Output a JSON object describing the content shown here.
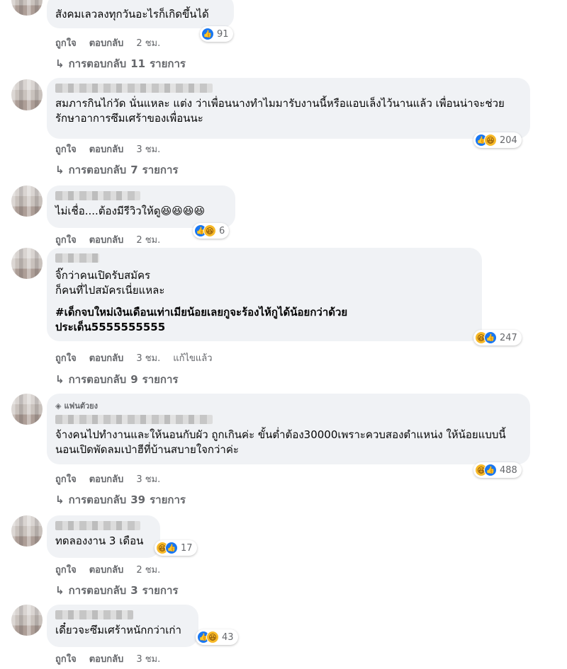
{
  "labels": {
    "like": "ถูกใจ",
    "reply": "ตอบกลับ"
  },
  "reply_prefix": "การตอบกลับ",
  "reply_suffix": "รายการ",
  "comments": [
    {
      "text": "สังคมเลวลงทุกวันอะไรก็เกิดขึ้นได้",
      "reactions": [
        "like"
      ],
      "count": "91",
      "time": "2 ชม.",
      "replies": "11"
    },
    {
      "text": "สมภารกินไก่วัด นั่นแหละ แต่ง ว่าเพื่อนนางทำไมมารับงานนี้หรือแอบเล็งไว้นานแล้ว เพื่อนน่าจะช่วยรักษาอาการซึมเศร้าของเพื่อนนะ",
      "reactions": [
        "like",
        "haha"
      ],
      "count": "204",
      "time": "3 ชม.",
      "replies": "7"
    },
    {
      "text": "ไม่เชื่อ....ต้องมีรีวิวให้ดู😆😆😆😆",
      "reactions": [
        "like",
        "haha"
      ],
      "count": "6",
      "time": "2 ชม.",
      "replies": ""
    },
    {
      "text": "จิ๊กว่าคนเปิดรับสมัคร\nก็คนที่ไปสมัครเนี่ยแหละ",
      "text_bold": "#เด็กจบใหม่เงินเดือนเท่าเมียน้อยเลยกูจะร้องไห้กูได้น้อยกว่าด้วย\nประเด็น5555555555",
      "reactions": [
        "haha",
        "like"
      ],
      "count": "247",
      "time": "3 ชม.",
      "edited": "แก้ไขแล้ว",
      "replies": "9"
    },
    {
      "badge": "แฟนตัวยง",
      "text": "จ้างคนไปทำงานและให้นอนกับผัว ถูกเกินค่ะ ขั้นต่ำต้อง30000เพราะควบสองตำแหน่ง ให้น้อยแบบนี้นอนเปิดพัดลมเป่าฮีที่บ้านสบายใจกว่าค่ะ",
      "reactions": [
        "haha",
        "like"
      ],
      "count": "488",
      "time": "3 ชม.",
      "replies": "39"
    },
    {
      "text": "ทดลองงาน 3 เดือน",
      "reactions": [
        "haha",
        "like"
      ],
      "count": "17",
      "time": "2 ชม.",
      "replies": "3"
    },
    {
      "text": "เดี๋ยวจะซึมเศร้าหนักกว่าเก่า",
      "reactions": [
        "like",
        "haha"
      ],
      "count": "43",
      "time": "3 ชม.",
      "replies": ""
    }
  ]
}
